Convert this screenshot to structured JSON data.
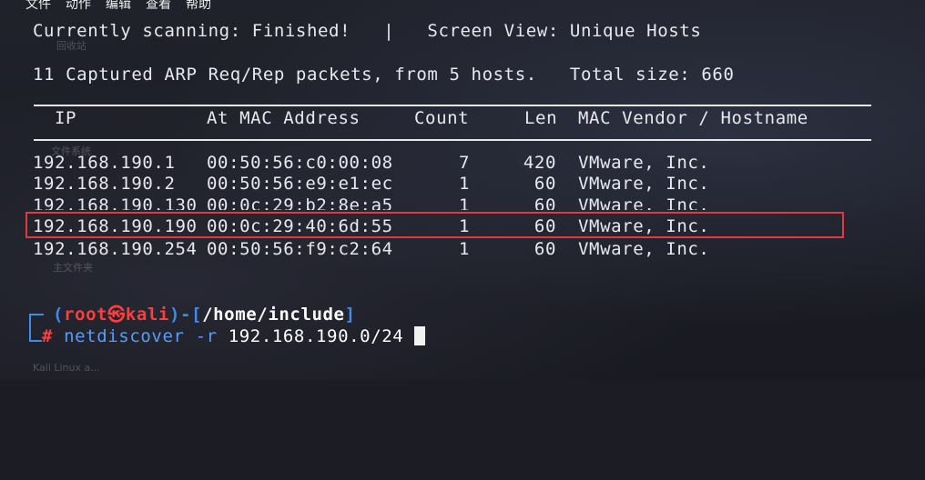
{
  "menubar": [
    "文件",
    "动作",
    "编辑",
    "查看",
    "帮助"
  ],
  "status": {
    "scan_line": "Currently scanning: Finished!   |   Screen View: Unique Hosts",
    "summary_line": "11 Captured ARP Req/Rep packets, from 5 hosts.   Total size: 660"
  },
  "table": {
    "headers": {
      "ip": "IP",
      "mac": "At MAC Address",
      "count": "Count",
      "len": "Len",
      "vendor": "MAC Vendor / Hostname"
    },
    "rows": [
      {
        "ip": "192.168.190.1",
        "mac": "00:50:56:c0:00:08",
        "count": "7",
        "len": "420",
        "vendor": "VMware, Inc."
      },
      {
        "ip": "192.168.190.2",
        "mac": "00:50:56:e9:e1:ec",
        "count": "1",
        "len": "60",
        "vendor": "VMware, Inc."
      },
      {
        "ip": "192.168.190.130",
        "mac": "00:0c:29:b2:8e:a5",
        "count": "1",
        "len": "60",
        "vendor": "VMware, Inc."
      },
      {
        "ip": "192.168.190.190",
        "mac": "00:0c:29:40:6d:55",
        "count": "1",
        "len": "60",
        "vendor": "VMware, Inc."
      },
      {
        "ip": "192.168.190.254",
        "mac": "00:50:56:f9:c2:64",
        "count": "1",
        "len": "60",
        "vendor": "VMware, Inc."
      }
    ],
    "highlighted_row": 3
  },
  "prompt": {
    "open": "(",
    "user": "root",
    "at_symbol": "㉿",
    "host": "kali",
    "close": ")-[",
    "path": "/home/include",
    "path_close": "]",
    "hash": "#",
    "command": "netdiscover",
    "args": "-r",
    "target": "192.168.190.0/24"
  },
  "desktop_ghost": [
    "回收站",
    "文件系统",
    "主文件夹",
    "Kali Linux a..."
  ],
  "colors": {
    "highlight_border": "#e03a3e",
    "prompt_blue": "#3f8cf0",
    "prompt_red": "#ff3d3d"
  }
}
